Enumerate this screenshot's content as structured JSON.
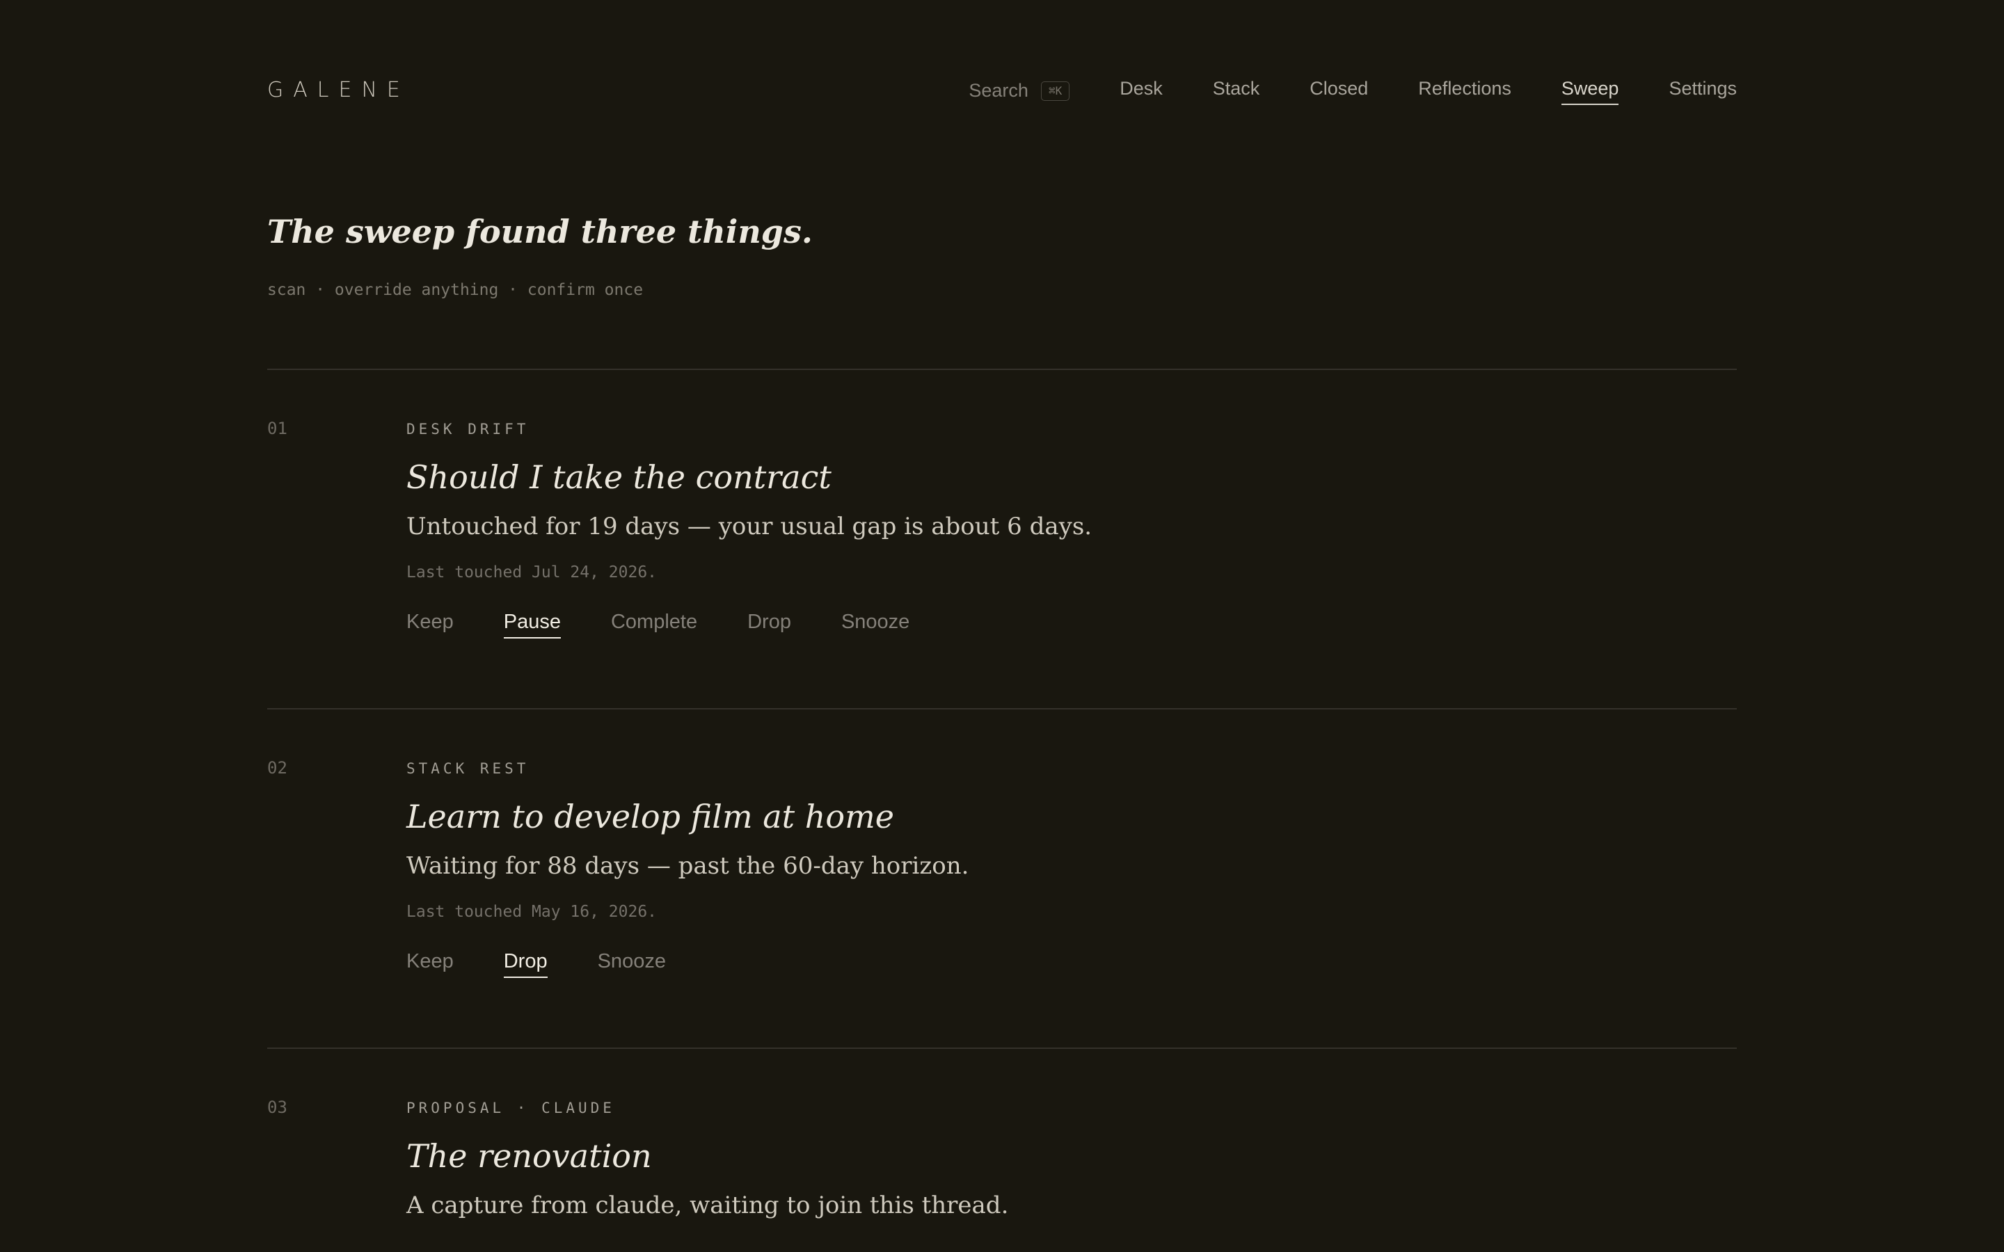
{
  "app": {
    "logo": "GALENE"
  },
  "nav": {
    "search_label": "Search",
    "search_shortcut": "⌘K",
    "items": [
      {
        "label": "Desk"
      },
      {
        "label": "Stack"
      },
      {
        "label": "Closed"
      },
      {
        "label": "Reflections"
      },
      {
        "label": "Sweep",
        "active": true
      },
      {
        "label": "Settings"
      }
    ]
  },
  "intro": {
    "title": "The sweep found three things.",
    "subtitle": "scan · override anything · confirm once"
  },
  "items": [
    {
      "number": "01",
      "eyebrow": "DESK DRIFT",
      "title": "Should I take the contract",
      "description": "Untouched for 19 days — your usual gap is about 6 days.",
      "meta": "Last touched Jul 24, 2026.",
      "actions": [
        "Keep",
        "Pause",
        "Complete",
        "Drop",
        "Snooze"
      ],
      "selected": "Pause"
    },
    {
      "number": "02",
      "eyebrow": "STACK REST",
      "title": "Learn to develop film at home",
      "description": "Waiting for 88 days — past the 60-day horizon.",
      "meta": "Last touched May 16, 2026.",
      "actions": [
        "Keep",
        "Drop",
        "Snooze"
      ],
      "selected": "Drop"
    },
    {
      "number": "03",
      "eyebrow": "PROPOSAL · CLAUDE",
      "title": "The renovation",
      "description": "A capture from claude, waiting to join this thread."
    }
  ]
}
